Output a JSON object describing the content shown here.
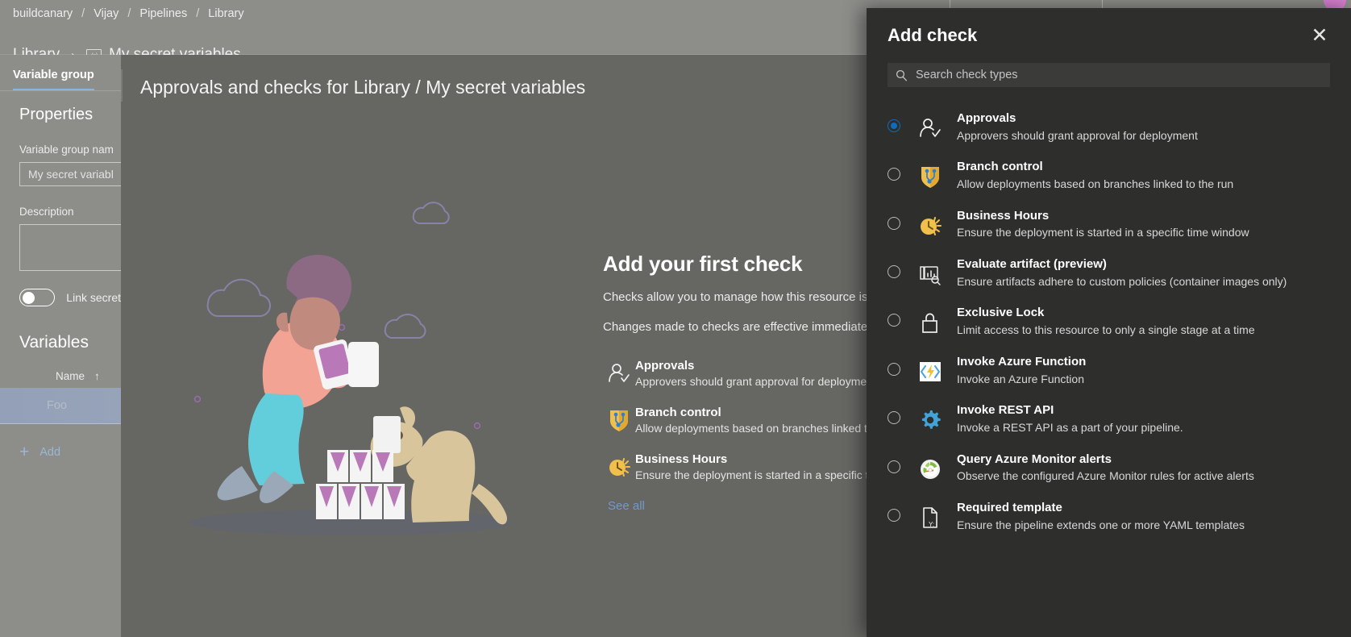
{
  "org_bar": {
    "crumbs": [
      "buildcanary",
      "Vijay",
      "Pipelines",
      "Library"
    ],
    "separator": "/"
  },
  "page_header": {
    "library_link": "Library",
    "chevron": "›",
    "variable_group_name": "My secret variables",
    "variable_icon": "variable-icon"
  },
  "left_pane": {
    "tab_label": "Variable group",
    "properties_heading": "Properties",
    "variable_group_name_label": "Variable group nam",
    "variable_group_name_value": "My secret variabl",
    "description_label": "Description",
    "description_value": "",
    "link_secrets_label": "Link secret",
    "link_secrets_on": false,
    "variables_heading": "Variables",
    "column_header_name": "Name",
    "sort_arrow": "↑",
    "rows": [
      {
        "name": "Foo"
      }
    ],
    "add_label": "Add",
    "add_icon": "plus-icon"
  },
  "center": {
    "title": "Approvals and checks for Library / My secret variables",
    "empty_state": {
      "heading": "Add your first check",
      "paragraph_1": "Checks allow you to manage how this resource is u",
      "paragraph_2": "Changes made to checks are effective immediately pipelines.",
      "see_all_label": "See all",
      "items": [
        {
          "icon": "approvals-icon",
          "name": "Approvals",
          "description": "Approvers should grant approval for deployment"
        },
        {
          "icon": "branch-control-icon",
          "name": "Branch control",
          "description": "Allow deployments based on branches linked to t"
        },
        {
          "icon": "business-hours-icon",
          "name": "Business Hours",
          "description": "Ensure the deployment is started in a specific tim"
        }
      ]
    }
  },
  "add_check_panel": {
    "title": "Add check",
    "close_icon": "close-icon",
    "search": {
      "icon": "search-icon",
      "placeholder": "Search check types",
      "value": ""
    },
    "selected_index": 0,
    "checks": [
      {
        "icon": "approvals-icon",
        "name": "Approvals",
        "description": "Approvers should grant approval for deployment",
        "selected": true
      },
      {
        "icon": "branch-control-icon",
        "name": "Branch control",
        "description": "Allow deployments based on branches linked to the run",
        "selected": false
      },
      {
        "icon": "business-hours-icon",
        "name": "Business Hours",
        "description": "Ensure the deployment is started in a specific time window",
        "selected": false
      },
      {
        "icon": "evaluate-artifact-icon",
        "name": "Evaluate artifact (preview)",
        "description": "Ensure artifacts adhere to custom policies (container images only)",
        "selected": false
      },
      {
        "icon": "exclusive-lock-icon",
        "name": "Exclusive Lock",
        "description": "Limit access to this resource to only a single stage at a time",
        "selected": false
      },
      {
        "icon": "azure-function-icon",
        "name": "Invoke Azure Function",
        "description": "Invoke an Azure Function",
        "selected": false
      },
      {
        "icon": "rest-api-gear-icon",
        "name": "Invoke REST API",
        "description": "Invoke a REST API as a part of your pipeline.",
        "selected": false
      },
      {
        "icon": "azure-monitor-icon",
        "name": "Query Azure Monitor alerts",
        "description": "Observe the configured Azure Monitor rules for active alerts",
        "selected": false
      },
      {
        "icon": "required-template-icon",
        "name": "Required template",
        "description": "Ensure the pipeline extends one or more YAML templates",
        "selected": false
      }
    ]
  },
  "colors": {
    "accent_blue": "#0f6cbd",
    "link_blue": "#6f9ad0",
    "panel_bg": "#2e2e2d",
    "app_bg": "#666663",
    "chrome_gray": "#8d8d8a",
    "amber": "#f0bf4c"
  }
}
